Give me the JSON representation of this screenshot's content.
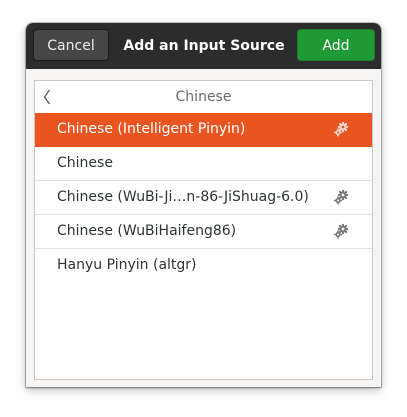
{
  "dialog": {
    "title": "Add an Input Source",
    "cancel_label": "Cancel",
    "add_label": "Add"
  },
  "list": {
    "header_title": "Chinese",
    "items": [
      {
        "label": "Chinese (Intelligent Pinyin)",
        "selected": true,
        "has_settings": true
      },
      {
        "label": "Chinese",
        "selected": false,
        "has_settings": false
      },
      {
        "label": "Chinese (WuBi-Ji…n-86-JiShuag-6.0)",
        "selected": false,
        "has_settings": true
      },
      {
        "label": "Chinese (WuBiHaifeng86)",
        "selected": false,
        "has_settings": true
      },
      {
        "label": "Hanyu Pinyin (altgr)",
        "selected": false,
        "has_settings": false
      }
    ]
  },
  "icons": {
    "back": "chevron-left-icon",
    "settings": "gears-icon"
  },
  "colors": {
    "accent": "#e95420",
    "add_button": "#1f9a36",
    "headerbar": "#2c2c2c"
  }
}
